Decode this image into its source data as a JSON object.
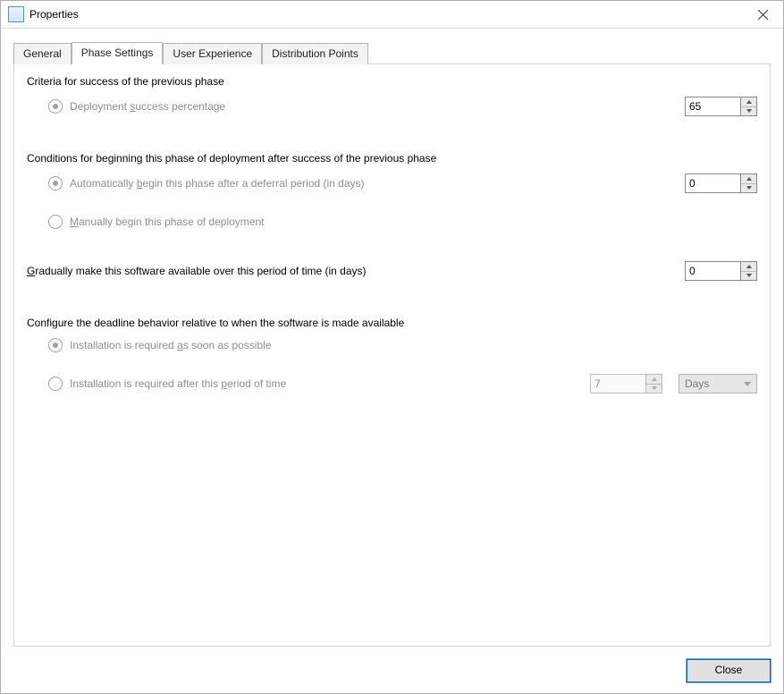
{
  "window": {
    "title": "Properties"
  },
  "tabs": [
    "General",
    "Phase Settings",
    "User Experience",
    "Distribution Points"
  ],
  "section1": {
    "label": "Criteria for success of the previous phase",
    "opt": {
      "pre": "Deployment ",
      "u": "s",
      "post": "uccess percentage"
    },
    "value": "65"
  },
  "section2": {
    "label": "Conditions for beginning this phase of deployment after success of the previous phase",
    "opt1": {
      "pre": "Automatically ",
      "u": "b",
      "post": "egin this phase after a deferral period (in days)"
    },
    "value": "0",
    "opt2": {
      "u": "M",
      "post": "anually begin this phase of deployment"
    }
  },
  "section3": {
    "label": {
      "u": "G",
      "post": "radually make this software available over this period of time (in days)"
    },
    "value": "0"
  },
  "section4": {
    "label": "Configure the deadline behavior relative to when the software is made available",
    "opt1": {
      "pre": "Installation is required ",
      "u": "a",
      "post": "s soon as possible"
    },
    "opt2": {
      "pre": "Installation is required after this ",
      "u": "p",
      "post": "eriod of time"
    },
    "value": "7",
    "unit": "Days"
  },
  "footer": {
    "close": "Close"
  }
}
